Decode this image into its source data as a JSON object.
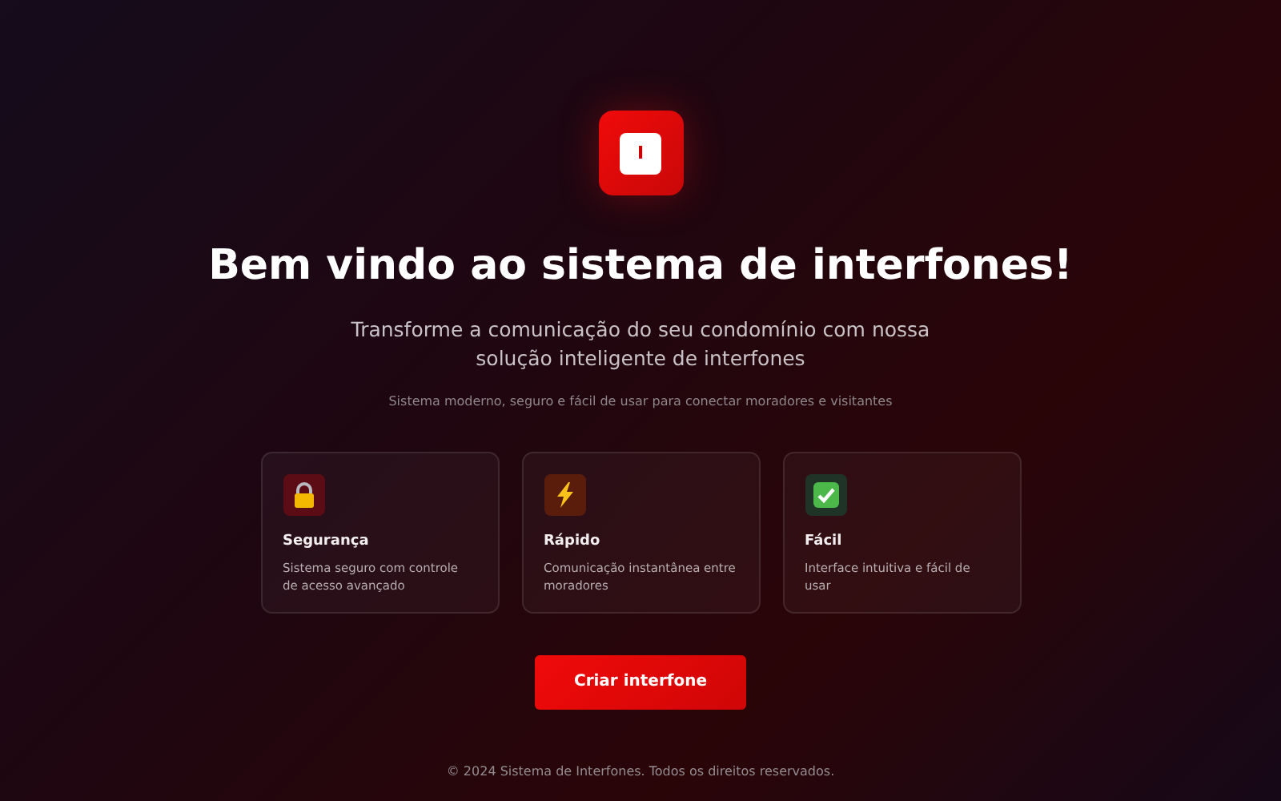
{
  "logo": {
    "letter": "I"
  },
  "title": "Bem vindo ao sistema de interfones!",
  "subtitle": "Transforme a comunicação do seu condomínio com nossa solução inteligente de interfones",
  "tagline": "Sistema moderno, seguro e fácil de usar para conectar moradores e visitantes",
  "features": [
    {
      "kind": "lock",
      "color": "#5c0c14",
      "title": "Segurança",
      "text": "Sistema seguro com controle de acesso avançado"
    },
    {
      "kind": "bolt",
      "color": "#5a1d0c",
      "title": "Rápido",
      "text": "Comunicação instantânea entre moradores"
    },
    {
      "kind": "check",
      "color": "#1f3427",
      "title": "Fácil",
      "text": "Interface intuitiva e fácil de usar"
    }
  ],
  "button": "Criar interfone",
  "footer": "© 2024 Sistema de Interfones. Todos os direitos reservados."
}
